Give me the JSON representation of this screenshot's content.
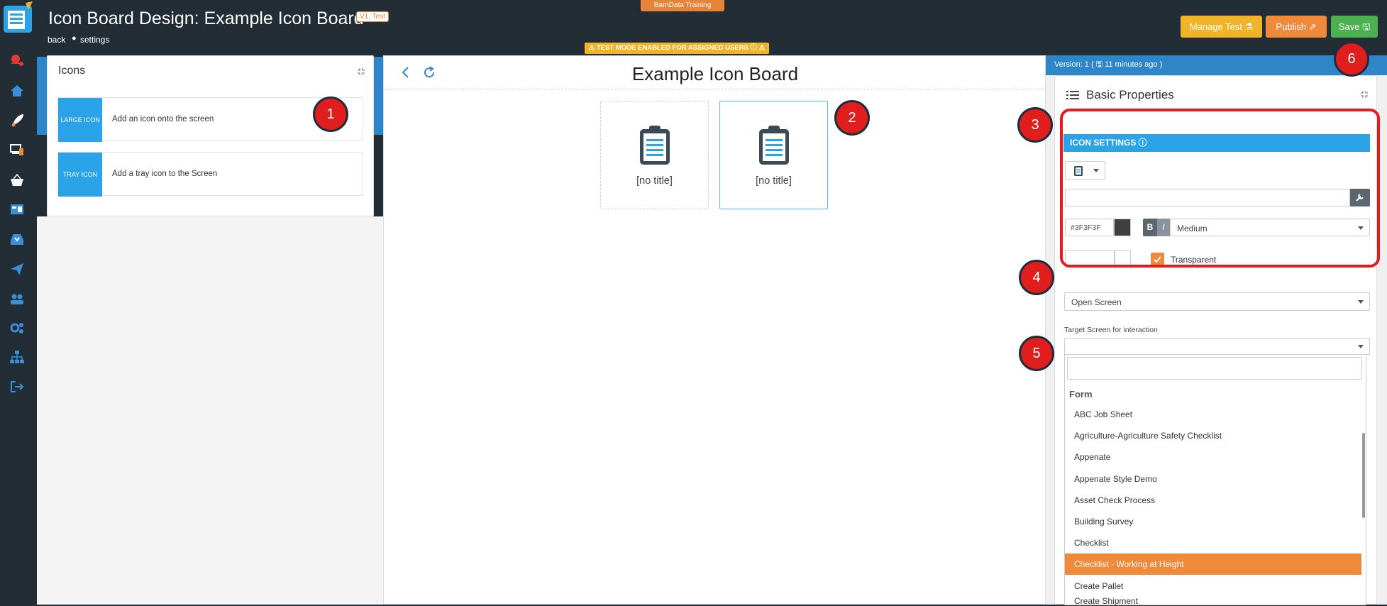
{
  "header": {
    "title": "Icon Board Design: Example Icon Board",
    "version_tag": "V1, Test",
    "back_link": "back",
    "separator": "●",
    "settings_link": "settings",
    "training_badge": "BarnData Training",
    "test_mode_banner": "⚠ TEST MODE ENABLED FOR ASSIGNED USERS ⓘ ⚠",
    "buttons": {
      "manage_test": "Manage Test ⚗",
      "publish": "Publish ⇗",
      "save": "Save 🖫"
    }
  },
  "nav": {
    "items": [
      "notifications-icon",
      "home-icon",
      "rocket-icon",
      "devices-icon",
      "basket-icon",
      "dashboard-icon",
      "inbox-icon",
      "send-icon",
      "users-icon",
      "settings-icon",
      "sitemap-icon",
      "logout-icon"
    ]
  },
  "icons_panel": {
    "title": "Icons",
    "items": [
      {
        "tile": "LARGE ICON",
        "description": "Add an icon onto the screen"
      },
      {
        "tile": "TRAY ICON",
        "description": "Add a tray icon to the Screen"
      }
    ]
  },
  "canvas": {
    "title": "Example Icon Board",
    "icons": [
      {
        "label": "[no title]"
      },
      {
        "label": "[no title]"
      }
    ]
  },
  "right_panel": {
    "version_text": "Version: 1 ( 🖫 11 minutes ago )",
    "props_title": "Basic Properties",
    "icon_settings": {
      "header": "ICON SETTINGS ⓘ",
      "color_value": "#3F3F3F",
      "bold_label": "B",
      "italic_label": "I",
      "size_value": "Medium",
      "transparent_label": "Transparent",
      "transparent_checked": true
    },
    "action_value": "Open Screen",
    "target_label": "Target Screen for interaction",
    "dropdown": {
      "group_label": "Form",
      "items": [
        "ABC Job Sheet",
        "Agriculture-Agriculture Safety Checklist",
        "Appenate",
        "Appenate Style Demo",
        "Asset Check Process",
        "Building Survey",
        "Checklist",
        "Checklist - Working at Height",
        "Create Pallet",
        "Create Shipment"
      ],
      "active_item": "Checklist - Working at Height"
    }
  },
  "markers": [
    "1",
    "2",
    "3",
    "4",
    "5",
    "6"
  ],
  "colors": {
    "nav_bg": "#232d36",
    "accent_blue": "#2e86c8",
    "tile_blue": "#2ba3e8",
    "orange": "#ee8a3a",
    "yellow": "#f0b429",
    "green": "#4caf50",
    "marker_red": "#e01e1e"
  }
}
